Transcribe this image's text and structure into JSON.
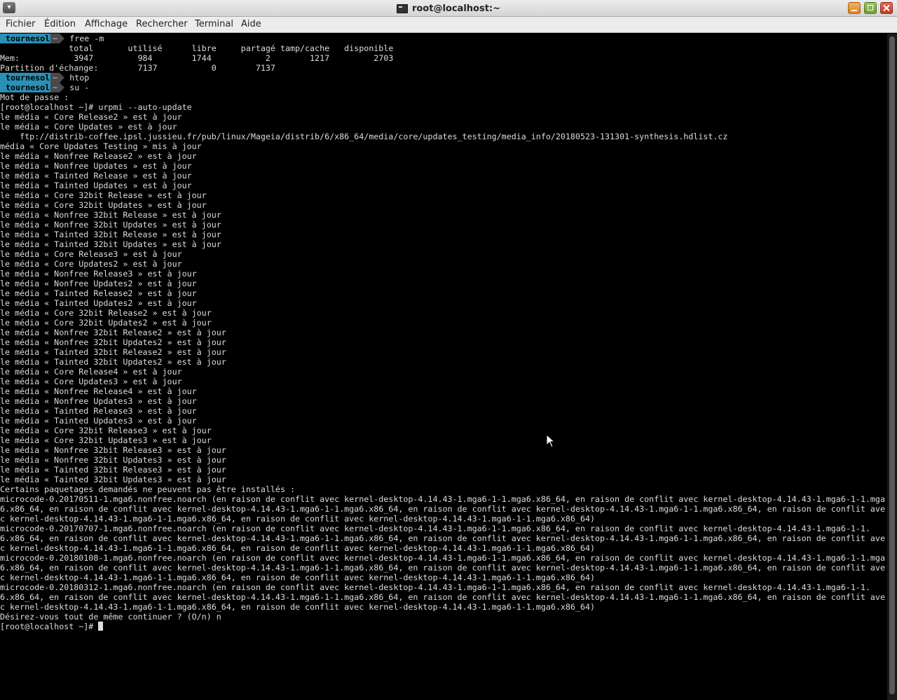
{
  "window": {
    "title": "root@localhost:~",
    "menu_button_glyph": "▾"
  },
  "menubar": {
    "items": [
      "Fichier",
      "Édition",
      "Affichage",
      "Rechercher",
      "Terminal",
      "Aide"
    ]
  },
  "prompt": {
    "user": "tournesol",
    "dir": "~"
  },
  "colors": {
    "background": "#000000",
    "text": "#dcdcdc",
    "prompt_user_bg": "#2a91b6",
    "prompt_dir_bg": "#4a4a4a"
  },
  "lines": [
    {
      "type": "prompt",
      "cmd": " free -m"
    },
    {
      "type": "text",
      "text": "              total       utilisé      libre     partagé tamp/cache   disponible"
    },
    {
      "type": "text",
      "text": "Mem:           3947         984        1744           2        1217         2703"
    },
    {
      "type": "text",
      "text": "Partition d'échange:        7137           0        7137"
    },
    {
      "type": "prompt",
      "cmd": " htop"
    },
    {
      "type": "prompt",
      "cmd": " su -"
    },
    {
      "type": "text",
      "text": "Mot de passe :"
    },
    {
      "type": "text",
      "text": "[root@localhost ~]# urpmi --auto-update"
    },
    {
      "type": "text",
      "text": "le média « Core Release2 » est à jour"
    },
    {
      "type": "text",
      "text": "le média « Core Updates » est à jour"
    },
    {
      "type": "text",
      "text": "    ftp://distrib-coffee.ipsl.jussieu.fr/pub/linux/Mageia/distrib/6/x86_64/media/core/updates_testing/media_info/20180523-131301-synthesis.hdlist.cz"
    },
    {
      "type": "text",
      "text": "média « Core Updates Testing » mis à jour"
    },
    {
      "type": "text",
      "text": "le média « Nonfree Release2 » est à jour"
    },
    {
      "type": "text",
      "text": "le média « Nonfree Updates » est à jour"
    },
    {
      "type": "text",
      "text": "le média « Tainted Release » est à jour"
    },
    {
      "type": "text",
      "text": "le média « Tainted Updates » est à jour"
    },
    {
      "type": "text",
      "text": "le média « Core 32bit Release » est à jour"
    },
    {
      "type": "text",
      "text": "le média « Core 32bit Updates » est à jour"
    },
    {
      "type": "text",
      "text": "le média « Nonfree 32bit Release » est à jour"
    },
    {
      "type": "text",
      "text": "le média « Nonfree 32bit Updates » est à jour"
    },
    {
      "type": "text",
      "text": "le média « Tainted 32bit Release » est à jour"
    },
    {
      "type": "text",
      "text": "le média « Tainted 32bit Updates » est à jour"
    },
    {
      "type": "text",
      "text": "le média « Core Release3 » est à jour"
    },
    {
      "type": "text",
      "text": "le média « Core Updates2 » est à jour"
    },
    {
      "type": "text",
      "text": "le média « Nonfree Release3 » est à jour"
    },
    {
      "type": "text",
      "text": "le média « Nonfree Updates2 » est à jour"
    },
    {
      "type": "text",
      "text": "le média « Tainted Release2 » est à jour"
    },
    {
      "type": "text",
      "text": "le média « Tainted Updates2 » est à jour"
    },
    {
      "type": "text",
      "text": "le média « Core 32bit Release2 » est à jour"
    },
    {
      "type": "text",
      "text": "le média « Core 32bit Updates2 » est à jour"
    },
    {
      "type": "text",
      "text": "le média « Nonfree 32bit Release2 » est à jour"
    },
    {
      "type": "text",
      "text": "le média « Nonfree 32bit Updates2 » est à jour"
    },
    {
      "type": "text",
      "text": "le média « Tainted 32bit Release2 » est à jour"
    },
    {
      "type": "text",
      "text": "le média « Tainted 32bit Updates2 » est à jour"
    },
    {
      "type": "text",
      "text": "le média « Core Release4 » est à jour"
    },
    {
      "type": "text",
      "text": "le média « Core Updates3 » est à jour"
    },
    {
      "type": "text",
      "text": "le média « Nonfree Release4 » est à jour"
    },
    {
      "type": "text",
      "text": "le média « Nonfree Updates3 » est à jour"
    },
    {
      "type": "text",
      "text": "le média « Tainted Release3 » est à jour"
    },
    {
      "type": "text",
      "text": "le média « Tainted Updates3 » est à jour"
    },
    {
      "type": "text",
      "text": "le média « Core 32bit Release3 » est à jour"
    },
    {
      "type": "text",
      "text": "le média « Core 32bit Updates3 » est à jour"
    },
    {
      "type": "text",
      "text": "le média « Nonfree 32bit Release3 » est à jour"
    },
    {
      "type": "text",
      "text": "le média « Nonfree 32bit Updates3 » est à jour"
    },
    {
      "type": "text",
      "text": "le média « Tainted 32bit Release3 » est à jour"
    },
    {
      "type": "text",
      "text": "le média « Tainted 32bit Updates3 » est à jour"
    },
    {
      "type": "text",
      "text": "Certains paquetages demandés ne peuvent pas être installés :"
    },
    {
      "type": "text",
      "text": "microcode-0.20170511-1.mga6.nonfree.noarch (en raison de conflit avec kernel-desktop-4.14.43-1.mga6-1-1.mga6.x86_64, en raison de conflit avec kernel-desktop-4.14.43-1.mga6-1-1.mga"
    },
    {
      "type": "text",
      "text": "6.x86_64, en raison de conflit avec kernel-desktop-4.14.43-1.mga6-1-1.mga6.x86_64, en raison de conflit avec kernel-desktop-4.14.43-1.mga6-1-1.mga6.x86_64, en raison de conflit ave"
    },
    {
      "type": "text",
      "text": "c kernel-desktop-4.14.43-1.mga6-1-1.mga6.x86_64, en raison de conflit avec kernel-desktop-4.14.43-1.mga6-1-1.mga6.x86_64)"
    },
    {
      "type": "text",
      "text": "microcode-0.20170707-1.mga6.nonfree.noarch (en raison de conflit avec kernel-desktop-4.14.43-1.mga6-1-1.mga6.x86_64, en raison de conflit avec kernel-desktop-4.14.43-1.mga6-1-1."
    },
    {
      "type": "text",
      "text": "6.x86_64, en raison de conflit avec kernel-desktop-4.14.43-1.mga6-1-1.mga6.x86_64, en raison de conflit avec kernel-desktop-4.14.43-1.mga6-1-1.mga6.x86_64, en raison de conflit ave"
    },
    {
      "type": "text",
      "text": "c kernel-desktop-4.14.43-1.mga6-1-1.mga6.x86_64, en raison de conflit avec kernel-desktop-4.14.43-1.mga6-1-1.mga6.x86_64)"
    },
    {
      "type": "text",
      "text": "microcode-0.20180108-1.mga6.nonfree.noarch (en raison de conflit avec kernel-desktop-4.14.43-1.mga6-1-1.mga6.x86_64, en raison de conflit avec kernel-desktop-4.14.43-1.mga6-1-1.mga"
    },
    {
      "type": "text",
      "text": "6.x86_64, en raison de conflit avec kernel-desktop-4.14.43-1.mga6-1-1.mga6.x86_64, en raison de conflit avec kernel-desktop-4.14.43-1.mga6-1-1.mga6.x86_64, en raison de conflit ave"
    },
    {
      "type": "text",
      "text": "c kernel-desktop-4.14.43-1.mga6-1-1.mga6.x86_64, en raison de conflit avec kernel-desktop-4.14.43-1.mga6-1-1.mga6.x86_64)"
    },
    {
      "type": "text",
      "text": "microcode-0.20180312-1.mga6.nonfree.noarch (en raison de conflit avec kernel-desktop-4.14.43-1.mga6-1-1.mga6.x86_64, en raison de conflit avec kernel-desktop-4.14.43-1.mga6-1-1."
    },
    {
      "type": "text",
      "text": "6.x86_64, en raison de conflit avec kernel-desktop-4.14.43-1.mga6-1-1.mga6.x86_64, en raison de conflit avec kernel-desktop-4.14.43-1.mga6-1-1.mga6.x86_64, en raison de conflit ave"
    },
    {
      "type": "text",
      "text": "c kernel-desktop-4.14.43-1.mga6-1-1.mga6.x86_64, en raison de conflit avec kernel-desktop-4.14.43-1.mga6-1-1.mga6.x86_64)"
    },
    {
      "type": "text",
      "text": "Désirez-vous tout de même continuer ? (O/n) n"
    },
    {
      "type": "cursor",
      "text": "[root@localhost ~]# "
    }
  ]
}
